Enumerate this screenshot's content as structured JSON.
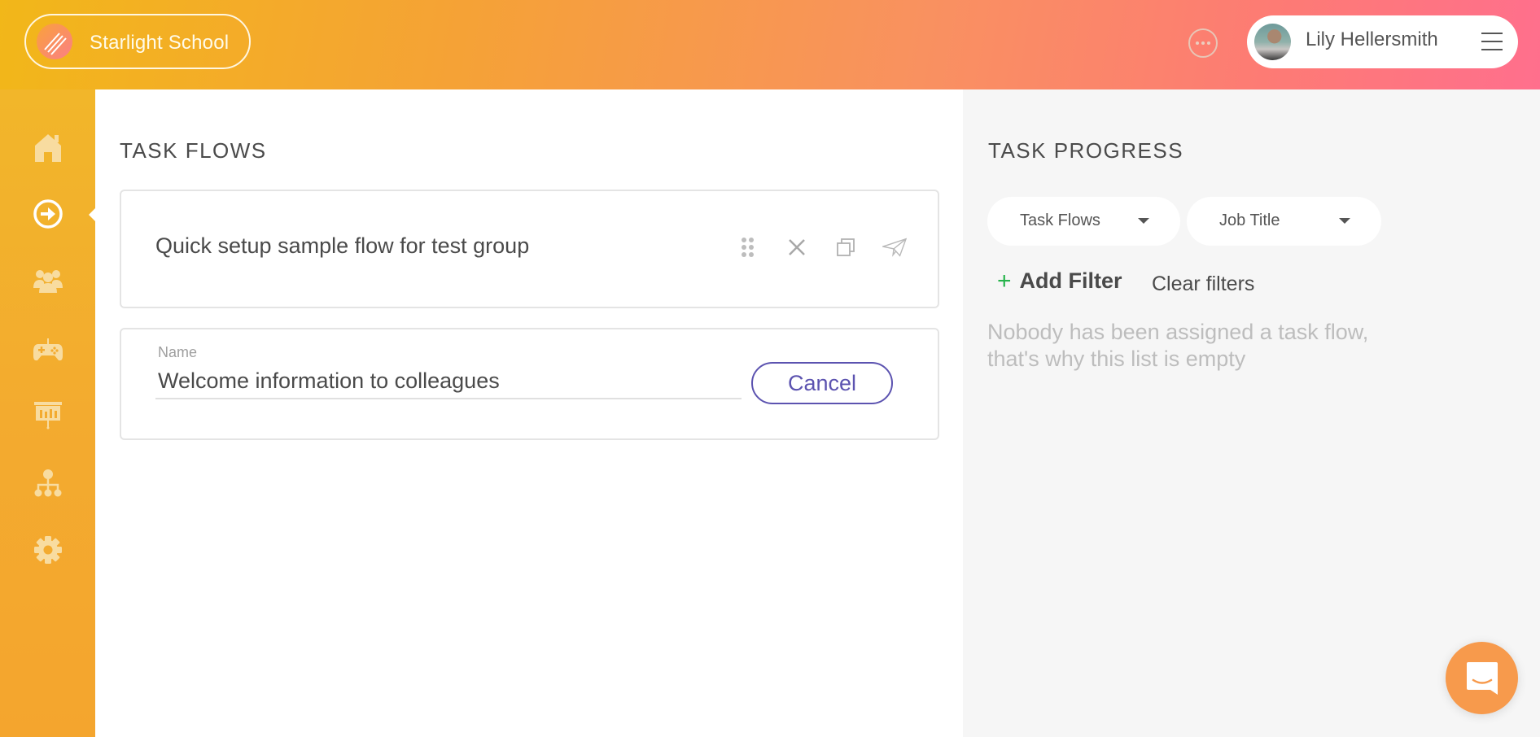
{
  "header": {
    "school_name": "Starlight School",
    "user_name": "Lily Hellersmith",
    "icons": {
      "logo": "starlight-logo-icon",
      "more": "more-dots-icon",
      "menu": "hamburger-menu-icon",
      "avatar": "user-avatar"
    }
  },
  "sidebar": {
    "items": [
      {
        "name": "home",
        "icon": "home-icon",
        "active": false
      },
      {
        "name": "task-flows",
        "icon": "arrow-circle-right-icon",
        "active": true
      },
      {
        "name": "people",
        "icon": "users-group-icon",
        "active": false
      },
      {
        "name": "games",
        "icon": "gamepad-icon",
        "active": false
      },
      {
        "name": "presentations",
        "icon": "presentation-board-icon",
        "active": false
      },
      {
        "name": "organization",
        "icon": "org-chart-icon",
        "active": false
      },
      {
        "name": "settings",
        "icon": "gear-icon",
        "active": false
      }
    ],
    "colors": {
      "icon_inactive": "#f8dca0",
      "icon_active": "#ffffff"
    }
  },
  "main": {
    "title": "TASK FLOWS",
    "flows": [
      {
        "title": "Quick setup sample flow for test group",
        "actions": [
          "drag-handle-icon",
          "delete-icon",
          "duplicate-icon",
          "send-icon"
        ]
      }
    ],
    "new_flow": {
      "field_label": "Name",
      "value": "Welcome information to colleagues",
      "cancel_label": "Cancel"
    }
  },
  "right_panel": {
    "title": "TASK PROGRESS",
    "dropdowns": [
      {
        "selected": "Task Flows"
      },
      {
        "selected": "Job Title"
      }
    ],
    "add_filter_label": "Add Filter",
    "clear_filters_label": "Clear filters",
    "empty_message": "Nobody has been assigned a task flow, that's why this list is empty"
  },
  "chat": {
    "icon": "chat-bubble-smile-icon"
  },
  "colors": {
    "accent_purple": "#5c53b0",
    "plus_green": "#25b34b",
    "chat_orange": "#f79a4c",
    "header_gradient_start": "#f2b719",
    "header_gradient_end": "#ff6f8d"
  }
}
